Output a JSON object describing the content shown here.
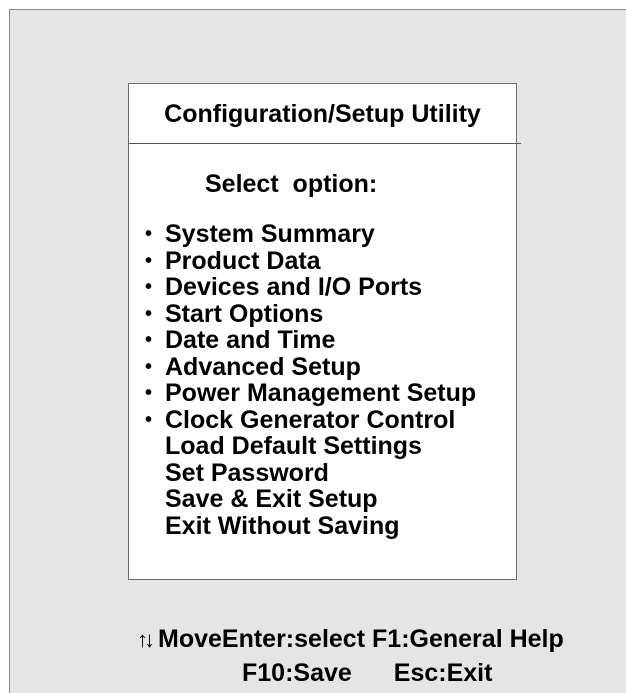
{
  "panel": {
    "title": "Configuration/Setup Utility",
    "prompt": "Select  option:",
    "items": [
      {
        "label": "System Summary",
        "bullet": true
      },
      {
        "label": "Product Data",
        "bullet": true
      },
      {
        "label": "Devices and I/O Ports",
        "bullet": true
      },
      {
        "label": "Start Options",
        "bullet": true
      },
      {
        "label": "Date and Time",
        "bullet": true
      },
      {
        "label": "Advanced Setup",
        "bullet": true
      },
      {
        "label": "Power Management Setup",
        "bullet": true
      },
      {
        "label": "Clock Generator Control",
        "bullet": true
      },
      {
        "label": "Load Default Settings",
        "bullet": false
      },
      {
        "label": "Set Password",
        "bullet": false
      },
      {
        "label": "Save & Exit Setup",
        "bullet": false
      },
      {
        "label": "Exit Without Saving",
        "bullet": false
      }
    ]
  },
  "footer": {
    "arrows_glyph": "↑↓",
    "move": "Move",
    "enter": "Enter:select",
    "f1": "F1:General Help",
    "f10": "F10:Save",
    "esc": "Esc:Exit"
  },
  "colors": {
    "background": "#e5e5e5",
    "panel": "#ffffff",
    "text": "#000000"
  }
}
